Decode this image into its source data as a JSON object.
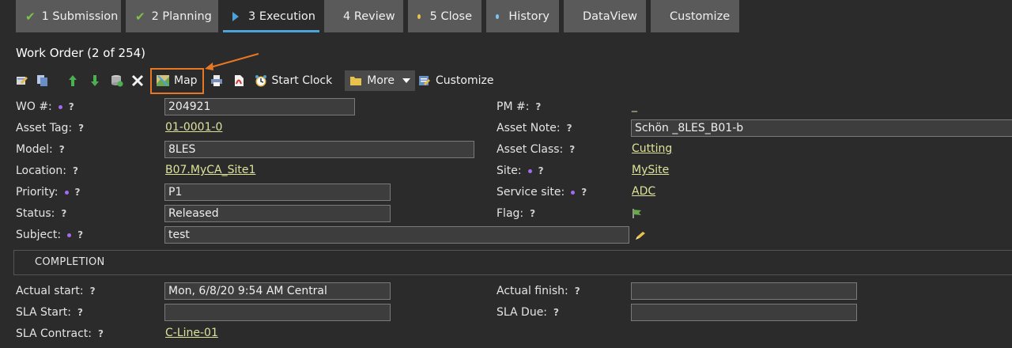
{
  "tabs": [
    {
      "label": "1 Submission",
      "icon": "check-icon"
    },
    {
      "label": "2 Planning",
      "icon": "check-icon"
    },
    {
      "label": "3 Execution",
      "icon": "play-icon"
    },
    {
      "label": "4 Review",
      "icon": "dot-icon"
    },
    {
      "label": "5 Close",
      "icon": "dot-icon"
    },
    {
      "label": "History",
      "icon": "dot-icon"
    },
    {
      "label": "DataView",
      "icon": "dot-icon"
    },
    {
      "label": "Customize",
      "icon": "dot-icon"
    }
  ],
  "title": "Work Order (2 of 254)",
  "toolbar": {
    "map_label": "Map",
    "start_clock_label": "Start Clock",
    "more_label": "More",
    "customize_label": "Customize"
  },
  "help_glyph": "?",
  "fields": {
    "wo_number": {
      "label": "WO #:",
      "value": "204921"
    },
    "pm_number": {
      "label": "PM #:",
      "value": "_"
    },
    "asset_tag": {
      "label": "Asset Tag:",
      "value": "01-0001-0"
    },
    "asset_note": {
      "label": "Asset Note:",
      "value": "Schön  _8LES_B01-b"
    },
    "model": {
      "label": "Model:",
      "value": "8LES"
    },
    "asset_class": {
      "label": "Asset Class:",
      "value": "Cutting"
    },
    "location": {
      "label": "Location:",
      "value": "B07.MyCA_Site1"
    },
    "site": {
      "label": "Site:",
      "value": "MySite"
    },
    "priority": {
      "label": "Priority:",
      "value": "P1"
    },
    "service_site": {
      "label": "Service site:",
      "value": "ADC"
    },
    "status": {
      "label": "Status:",
      "value": "Released"
    },
    "flag": {
      "label": "Flag:"
    },
    "subject": {
      "label": "Subject:",
      "value": "test"
    }
  },
  "completion": {
    "heading": "COMPLETION",
    "actual_start": {
      "label": "Actual start:",
      "value": "Mon, 6/8/20 9:54 AM Central"
    },
    "actual_finish": {
      "label": "Actual finish:",
      "value": ""
    },
    "sla_start": {
      "label": "SLA Start:",
      "value": ""
    },
    "sla_due": {
      "label": "SLA Due:",
      "value": ""
    },
    "sla_contract": {
      "label": "SLA Contract:",
      "value": "C-Line-01"
    }
  },
  "colors": {
    "background": "#2b2b2b",
    "tab": "#5a5a5a",
    "active_tab_underline": "#4ba3d9",
    "check": "#7dc24b",
    "link": "#dde39a",
    "required_dot": "#a56bf0",
    "highlight_border": "#e87722",
    "dot_colors": {
      "Review": "#e8c24b",
      "Close": "#e8c24b",
      "History": "#7ec2f0",
      "DataView": "#7ec2f0",
      "Customize": "#7ec2f0"
    }
  }
}
